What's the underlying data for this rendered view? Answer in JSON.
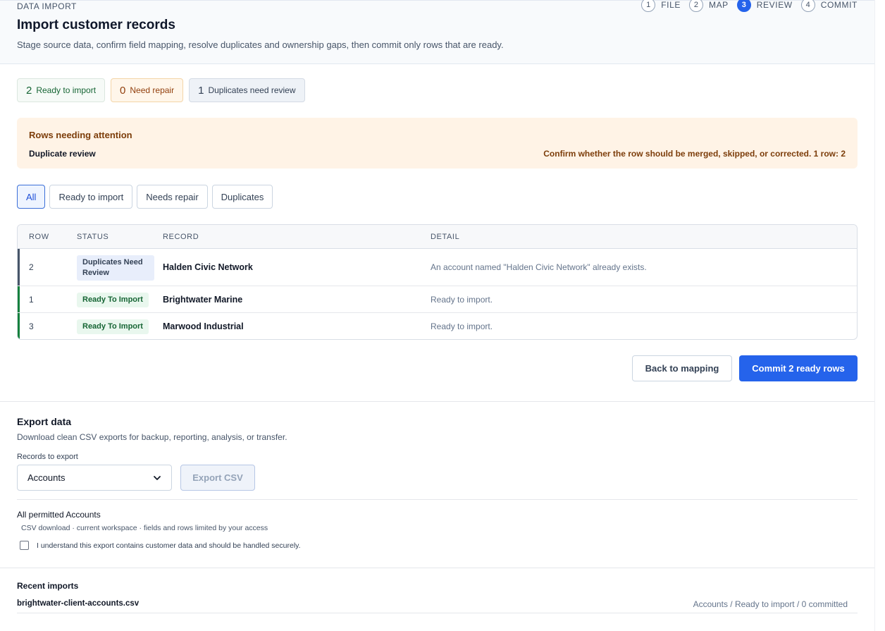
{
  "header": {
    "eyebrow": "DATA IMPORT",
    "title": "Import customer records",
    "subtitle": "Stage source data, confirm field mapping, resolve duplicates and ownership gaps, then commit only rows that are ready."
  },
  "stepper": [
    {
      "num": "1",
      "label": "FILE",
      "active": false
    },
    {
      "num": "2",
      "label": "MAP",
      "active": false
    },
    {
      "num": "3",
      "label": "REVIEW",
      "active": true
    },
    {
      "num": "4",
      "label": "COMMIT",
      "active": false
    }
  ],
  "stats": {
    "ready": {
      "count": "2",
      "label": "Ready to import"
    },
    "repair": {
      "count": "0",
      "label": "Need repair"
    },
    "duplicates": {
      "count": "1",
      "label": "Duplicates need review"
    }
  },
  "banner": {
    "title": "Rows needing attention",
    "label": "Duplicate review",
    "message": "Confirm whether the row should be merged, skipped, or corrected. 1 row: 2"
  },
  "filters": {
    "all": "All",
    "ready": "Ready to import",
    "repair": "Needs repair",
    "duplicates": "Duplicates",
    "selected": "All"
  },
  "table": {
    "headers": {
      "row": "ROW",
      "status": "STATUS",
      "record": "RECORD",
      "detail": "DETAIL"
    },
    "rows": [
      {
        "row": "2",
        "status": "Duplicates Need Review",
        "record": "Halden Civic Network",
        "detail": "An account named \"Halden Civic Network\" already exists."
      },
      {
        "row": "1",
        "status": "Ready To Import",
        "record": "Brightwater Marine",
        "detail": "Ready to import."
      },
      {
        "row": "3",
        "status": "Ready To Import",
        "record": "Marwood Industrial",
        "detail": "Ready to import."
      }
    ]
  },
  "actions": {
    "back": "Back to mapping",
    "commit": "Commit 2 ready rows"
  },
  "export": {
    "title": "Export data",
    "description": "Download clean CSV exports for backup, reporting, analysis, or transfer.",
    "field_label": "Records to export",
    "selected_value": "Accounts",
    "button": "Export CSV",
    "scope_title": "All permitted Accounts",
    "scope_meta": "CSV download · current workspace · fields and rows limited by your access",
    "checkbox_label": "I understand this export contains customer data and should be handled securely.",
    "checkbox_checked": false
  },
  "recent": {
    "title": "Recent imports",
    "file": "brightwater-client-accounts.csv",
    "status": "Accounts / Ready to import / 0 committed"
  },
  "colors": {
    "primary": "#2563eb",
    "duplicate_accent": "#475569",
    "ready_accent": "#15803d",
    "warning_text": "#7c3d0a"
  },
  "icons": {
    "select_chevron": "chevron-down-icon",
    "checkbox": "checkbox-icon"
  }
}
